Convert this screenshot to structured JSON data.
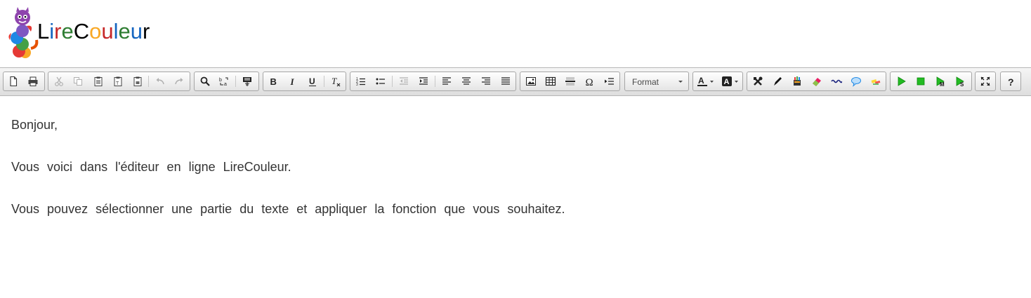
{
  "logo": {
    "letters": [
      {
        "ch": "L",
        "color": "#000000"
      },
      {
        "ch": "i",
        "color": "#1565c0"
      },
      {
        "ch": "r",
        "color": "#c62828"
      },
      {
        "ch": "e",
        "color": "#2e7d32"
      },
      {
        "ch": "C",
        "color": "#000000"
      },
      {
        "ch": "o",
        "color": "#f9a825"
      },
      {
        "ch": "u",
        "color": "#c62828"
      },
      {
        "ch": "l",
        "color": "#1565c0"
      },
      {
        "ch": "e",
        "color": "#2e7d32"
      },
      {
        "ch": "u",
        "color": "#1565c0"
      },
      {
        "ch": "r",
        "color": "#000000"
      }
    ]
  },
  "toolbar": {
    "format_label": "Format",
    "icons": [
      "new-page-icon",
      "print-icon",
      "cut-icon",
      "copy-icon",
      "paste-icon",
      "paste-text-icon",
      "paste-word-icon",
      "undo-icon",
      "redo-icon",
      "find-icon",
      "replace-icon",
      "templates-icon",
      "bold-icon",
      "italic-icon",
      "underline-icon",
      "remove-format-icon",
      "numbered-list-icon",
      "bulleted-list-icon",
      "outdent-icon",
      "indent-icon",
      "align-left-icon",
      "align-center-icon",
      "align-right-icon",
      "justify-icon",
      "image-icon",
      "table-icon",
      "horizontal-line-icon",
      "special-char-icon",
      "page-break-icon",
      "text-color-icon",
      "background-color-icon",
      "tools-icon",
      "pen-icon",
      "colored-pencils-icon",
      "eraser-icon",
      "wave-line-icon",
      "speech-bubble-icon",
      "highlighter-icon",
      "play-icon",
      "stop-icon",
      "play-m-icon",
      "play-s-icon",
      "maximize-icon",
      "help-icon"
    ],
    "accent_green": "#22bb22"
  },
  "content": {
    "paragraphs": [
      "Bonjour,",
      "Vous voici dans l'éditeur en ligne LireCouleur.",
      "Vous pouvez sélectionner une partie du texte et appliquer la fonction que vous souhaitez."
    ]
  }
}
